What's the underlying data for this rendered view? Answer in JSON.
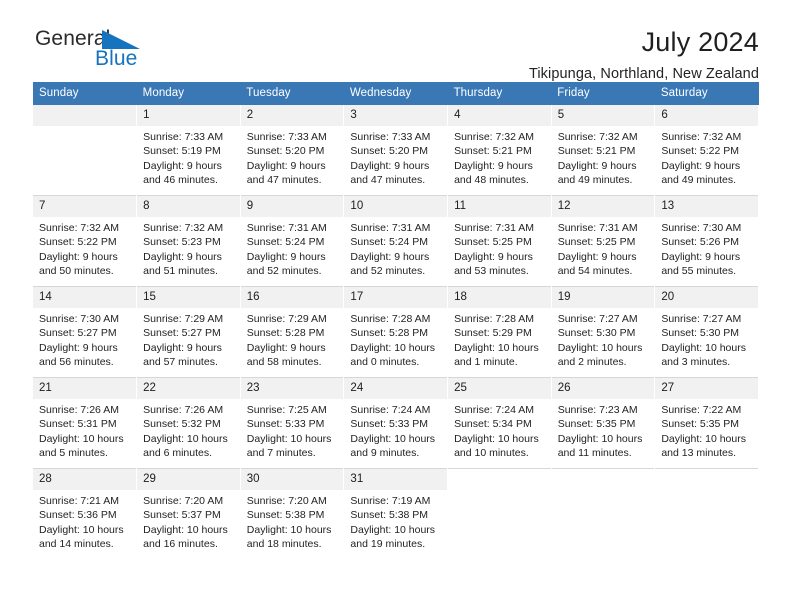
{
  "brand": {
    "name_part1": "General",
    "name_part2": "Blue",
    "triangle_color": "#1673bd"
  },
  "header": {
    "title": "July 2024",
    "location": "Tikipunga, Northland, New Zealand",
    "header_bg_color": "#3a78b5",
    "daynum_bg_color": "#f1f1f1"
  },
  "weekday_headers": [
    "Sunday",
    "Monday",
    "Tuesday",
    "Wednesday",
    "Thursday",
    "Friday",
    "Saturday"
  ],
  "weeks": [
    [
      {
        "day": "",
        "empty": true,
        "sunrise": "",
        "sunset": "",
        "daylight1": "",
        "daylight2": ""
      },
      {
        "day": "1",
        "sunrise": "Sunrise: 7:33 AM",
        "sunset": "Sunset: 5:19 PM",
        "daylight1": "Daylight: 9 hours",
        "daylight2": "and 46 minutes."
      },
      {
        "day": "2",
        "sunrise": "Sunrise: 7:33 AM",
        "sunset": "Sunset: 5:20 PM",
        "daylight1": "Daylight: 9 hours",
        "daylight2": "and 47 minutes."
      },
      {
        "day": "3",
        "sunrise": "Sunrise: 7:33 AM",
        "sunset": "Sunset: 5:20 PM",
        "daylight1": "Daylight: 9 hours",
        "daylight2": "and 47 minutes."
      },
      {
        "day": "4",
        "sunrise": "Sunrise: 7:32 AM",
        "sunset": "Sunset: 5:21 PM",
        "daylight1": "Daylight: 9 hours",
        "daylight2": "and 48 minutes."
      },
      {
        "day": "5",
        "sunrise": "Sunrise: 7:32 AM",
        "sunset": "Sunset: 5:21 PM",
        "daylight1": "Daylight: 9 hours",
        "daylight2": "and 49 minutes."
      },
      {
        "day": "6",
        "sunrise": "Sunrise: 7:32 AM",
        "sunset": "Sunset: 5:22 PM",
        "daylight1": "Daylight: 9 hours",
        "daylight2": "and 49 minutes."
      }
    ],
    [
      {
        "day": "7",
        "sunrise": "Sunrise: 7:32 AM",
        "sunset": "Sunset: 5:22 PM",
        "daylight1": "Daylight: 9 hours",
        "daylight2": "and 50 minutes."
      },
      {
        "day": "8",
        "sunrise": "Sunrise: 7:32 AM",
        "sunset": "Sunset: 5:23 PM",
        "daylight1": "Daylight: 9 hours",
        "daylight2": "and 51 minutes."
      },
      {
        "day": "9",
        "sunrise": "Sunrise: 7:31 AM",
        "sunset": "Sunset: 5:24 PM",
        "daylight1": "Daylight: 9 hours",
        "daylight2": "and 52 minutes."
      },
      {
        "day": "10",
        "sunrise": "Sunrise: 7:31 AM",
        "sunset": "Sunset: 5:24 PM",
        "daylight1": "Daylight: 9 hours",
        "daylight2": "and 52 minutes."
      },
      {
        "day": "11",
        "sunrise": "Sunrise: 7:31 AM",
        "sunset": "Sunset: 5:25 PM",
        "daylight1": "Daylight: 9 hours",
        "daylight2": "and 53 minutes."
      },
      {
        "day": "12",
        "sunrise": "Sunrise: 7:31 AM",
        "sunset": "Sunset: 5:25 PM",
        "daylight1": "Daylight: 9 hours",
        "daylight2": "and 54 minutes."
      },
      {
        "day": "13",
        "sunrise": "Sunrise: 7:30 AM",
        "sunset": "Sunset: 5:26 PM",
        "daylight1": "Daylight: 9 hours",
        "daylight2": "and 55 minutes."
      }
    ],
    [
      {
        "day": "14",
        "sunrise": "Sunrise: 7:30 AM",
        "sunset": "Sunset: 5:27 PM",
        "daylight1": "Daylight: 9 hours",
        "daylight2": "and 56 minutes."
      },
      {
        "day": "15",
        "sunrise": "Sunrise: 7:29 AM",
        "sunset": "Sunset: 5:27 PM",
        "daylight1": "Daylight: 9 hours",
        "daylight2": "and 57 minutes."
      },
      {
        "day": "16",
        "sunrise": "Sunrise: 7:29 AM",
        "sunset": "Sunset: 5:28 PM",
        "daylight1": "Daylight: 9 hours",
        "daylight2": "and 58 minutes."
      },
      {
        "day": "17",
        "sunrise": "Sunrise: 7:28 AM",
        "sunset": "Sunset: 5:28 PM",
        "daylight1": "Daylight: 10 hours",
        "daylight2": "and 0 minutes."
      },
      {
        "day": "18",
        "sunrise": "Sunrise: 7:28 AM",
        "sunset": "Sunset: 5:29 PM",
        "daylight1": "Daylight: 10 hours",
        "daylight2": "and 1 minute."
      },
      {
        "day": "19",
        "sunrise": "Sunrise: 7:27 AM",
        "sunset": "Sunset: 5:30 PM",
        "daylight1": "Daylight: 10 hours",
        "daylight2": "and 2 minutes."
      },
      {
        "day": "20",
        "sunrise": "Sunrise: 7:27 AM",
        "sunset": "Sunset: 5:30 PM",
        "daylight1": "Daylight: 10 hours",
        "daylight2": "and 3 minutes."
      }
    ],
    [
      {
        "day": "21",
        "sunrise": "Sunrise: 7:26 AM",
        "sunset": "Sunset: 5:31 PM",
        "daylight1": "Daylight: 10 hours",
        "daylight2": "and 5 minutes."
      },
      {
        "day": "22",
        "sunrise": "Sunrise: 7:26 AM",
        "sunset": "Sunset: 5:32 PM",
        "daylight1": "Daylight: 10 hours",
        "daylight2": "and 6 minutes."
      },
      {
        "day": "23",
        "sunrise": "Sunrise: 7:25 AM",
        "sunset": "Sunset: 5:33 PM",
        "daylight1": "Daylight: 10 hours",
        "daylight2": "and 7 minutes."
      },
      {
        "day": "24",
        "sunrise": "Sunrise: 7:24 AM",
        "sunset": "Sunset: 5:33 PM",
        "daylight1": "Daylight: 10 hours",
        "daylight2": "and 9 minutes."
      },
      {
        "day": "25",
        "sunrise": "Sunrise: 7:24 AM",
        "sunset": "Sunset: 5:34 PM",
        "daylight1": "Daylight: 10 hours",
        "daylight2": "and 10 minutes."
      },
      {
        "day": "26",
        "sunrise": "Sunrise: 7:23 AM",
        "sunset": "Sunset: 5:35 PM",
        "daylight1": "Daylight: 10 hours",
        "daylight2": "and 11 minutes."
      },
      {
        "day": "27",
        "sunrise": "Sunrise: 7:22 AM",
        "sunset": "Sunset: 5:35 PM",
        "daylight1": "Daylight: 10 hours",
        "daylight2": "and 13 minutes."
      }
    ],
    [
      {
        "day": "28",
        "sunrise": "Sunrise: 7:21 AM",
        "sunset": "Sunset: 5:36 PM",
        "daylight1": "Daylight: 10 hours",
        "daylight2": "and 14 minutes."
      },
      {
        "day": "29",
        "sunrise": "Sunrise: 7:20 AM",
        "sunset": "Sunset: 5:37 PM",
        "daylight1": "Daylight: 10 hours",
        "daylight2": "and 16 minutes."
      },
      {
        "day": "30",
        "sunrise": "Sunrise: 7:20 AM",
        "sunset": "Sunset: 5:38 PM",
        "daylight1": "Daylight: 10 hours",
        "daylight2": "and 18 minutes."
      },
      {
        "day": "31",
        "sunrise": "Sunrise: 7:19 AM",
        "sunset": "Sunset: 5:38 PM",
        "daylight1": "Daylight: 10 hours",
        "daylight2": "and 19 minutes."
      },
      {
        "day": "",
        "empty": true,
        "blank": true,
        "sunrise": "",
        "sunset": "",
        "daylight1": "",
        "daylight2": ""
      },
      {
        "day": "",
        "empty": true,
        "blank": true,
        "sunrise": "",
        "sunset": "",
        "daylight1": "",
        "daylight2": ""
      },
      {
        "day": "",
        "empty": true,
        "blank": true,
        "sunrise": "",
        "sunset": "",
        "daylight1": "",
        "daylight2": ""
      }
    ]
  ]
}
